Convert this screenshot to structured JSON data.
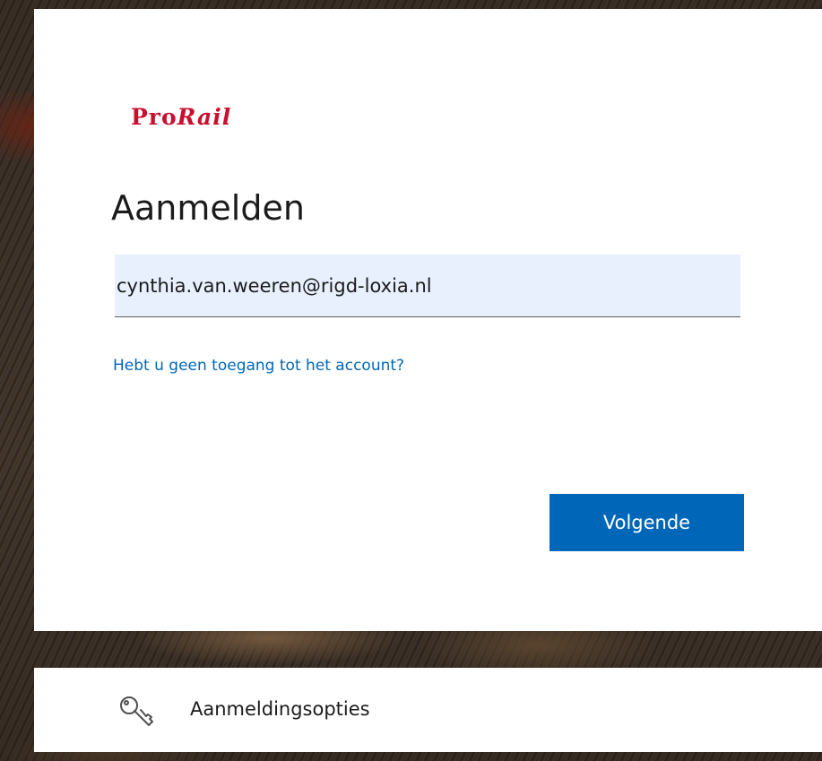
{
  "brand": {
    "logo_prefix": "Pro",
    "logo_suffix": "Rail",
    "logo_color": "#c8102e"
  },
  "signin": {
    "title": "Aanmelden",
    "email_value": "cynthia.van.weeren@rigd-loxia.nl",
    "help_link": "Hebt u geen toegang tot het account?",
    "next_button": "Volgende"
  },
  "options": {
    "label": "Aanmeldingsopties",
    "icon": "key-icon"
  },
  "colors": {
    "accent": "#0067b8",
    "input_autofill_bg": "#e8f0fe"
  }
}
